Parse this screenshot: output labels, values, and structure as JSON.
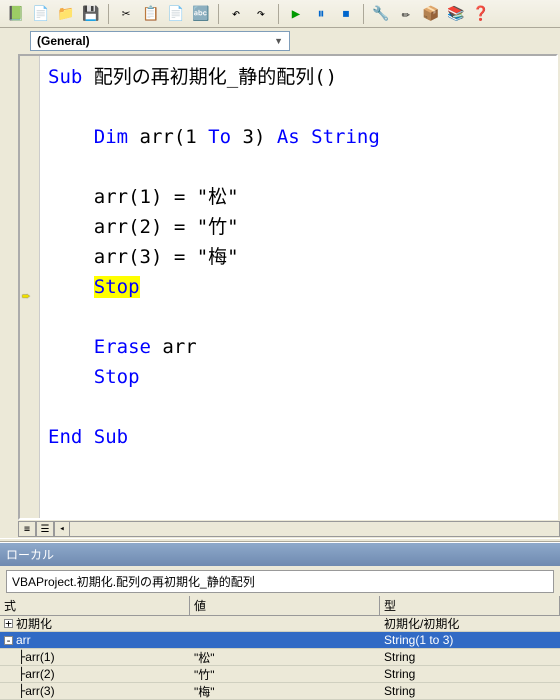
{
  "toolbar": {
    "icons": [
      "📗",
      "📄",
      "📁",
      "💾",
      "✂",
      "📋",
      "📄",
      "🔤",
      "↶",
      "↷",
      "▶",
      "⏸",
      "⏹",
      "🔧",
      "✏",
      "📦",
      "📚",
      "❓"
    ]
  },
  "dropdown": {
    "label": "(General)"
  },
  "code": {
    "l1_kw": "Sub",
    "l1_rest": " 配列の再初期化_静的配列()",
    "l3_kw1": "Dim",
    "l3_mid": " arr(1 ",
    "l3_kw2": "To",
    "l3_mid2": " 3) ",
    "l3_kw3": "As String",
    "l5": "arr(1) = \"松\"",
    "l6": "arr(2) = \"竹\"",
    "l7": "arr(3) = \"梅\"",
    "l8_kw": "Stop",
    "l10_kw": "Erase",
    "l10_rest": " arr",
    "l11_kw": "Stop",
    "l13_kw": "End Sub"
  },
  "locals": {
    "title": "ローカル",
    "context": "VBAProject.初期化.配列の再初期化_静的配列",
    "headers": {
      "expr": "式",
      "val": "値",
      "type": "型"
    },
    "rows": [
      {
        "toggle": "+",
        "indent": 0,
        "expr": "初期化",
        "val": "",
        "type": "初期化/初期化",
        "sel": false
      },
      {
        "toggle": "-",
        "indent": 0,
        "expr": "arr",
        "val": "",
        "type": "String(1 to 3)",
        "sel": true
      },
      {
        "toggle": "",
        "indent": 1,
        "expr": "arr(1)",
        "val": "\"松\"",
        "type": "String",
        "sel": false
      },
      {
        "toggle": "",
        "indent": 1,
        "expr": "arr(2)",
        "val": "\"竹\"",
        "type": "String",
        "sel": false
      },
      {
        "toggle": "",
        "indent": 1,
        "expr": "arr(3)",
        "val": "\"梅\"",
        "type": "String",
        "sel": false
      }
    ]
  }
}
